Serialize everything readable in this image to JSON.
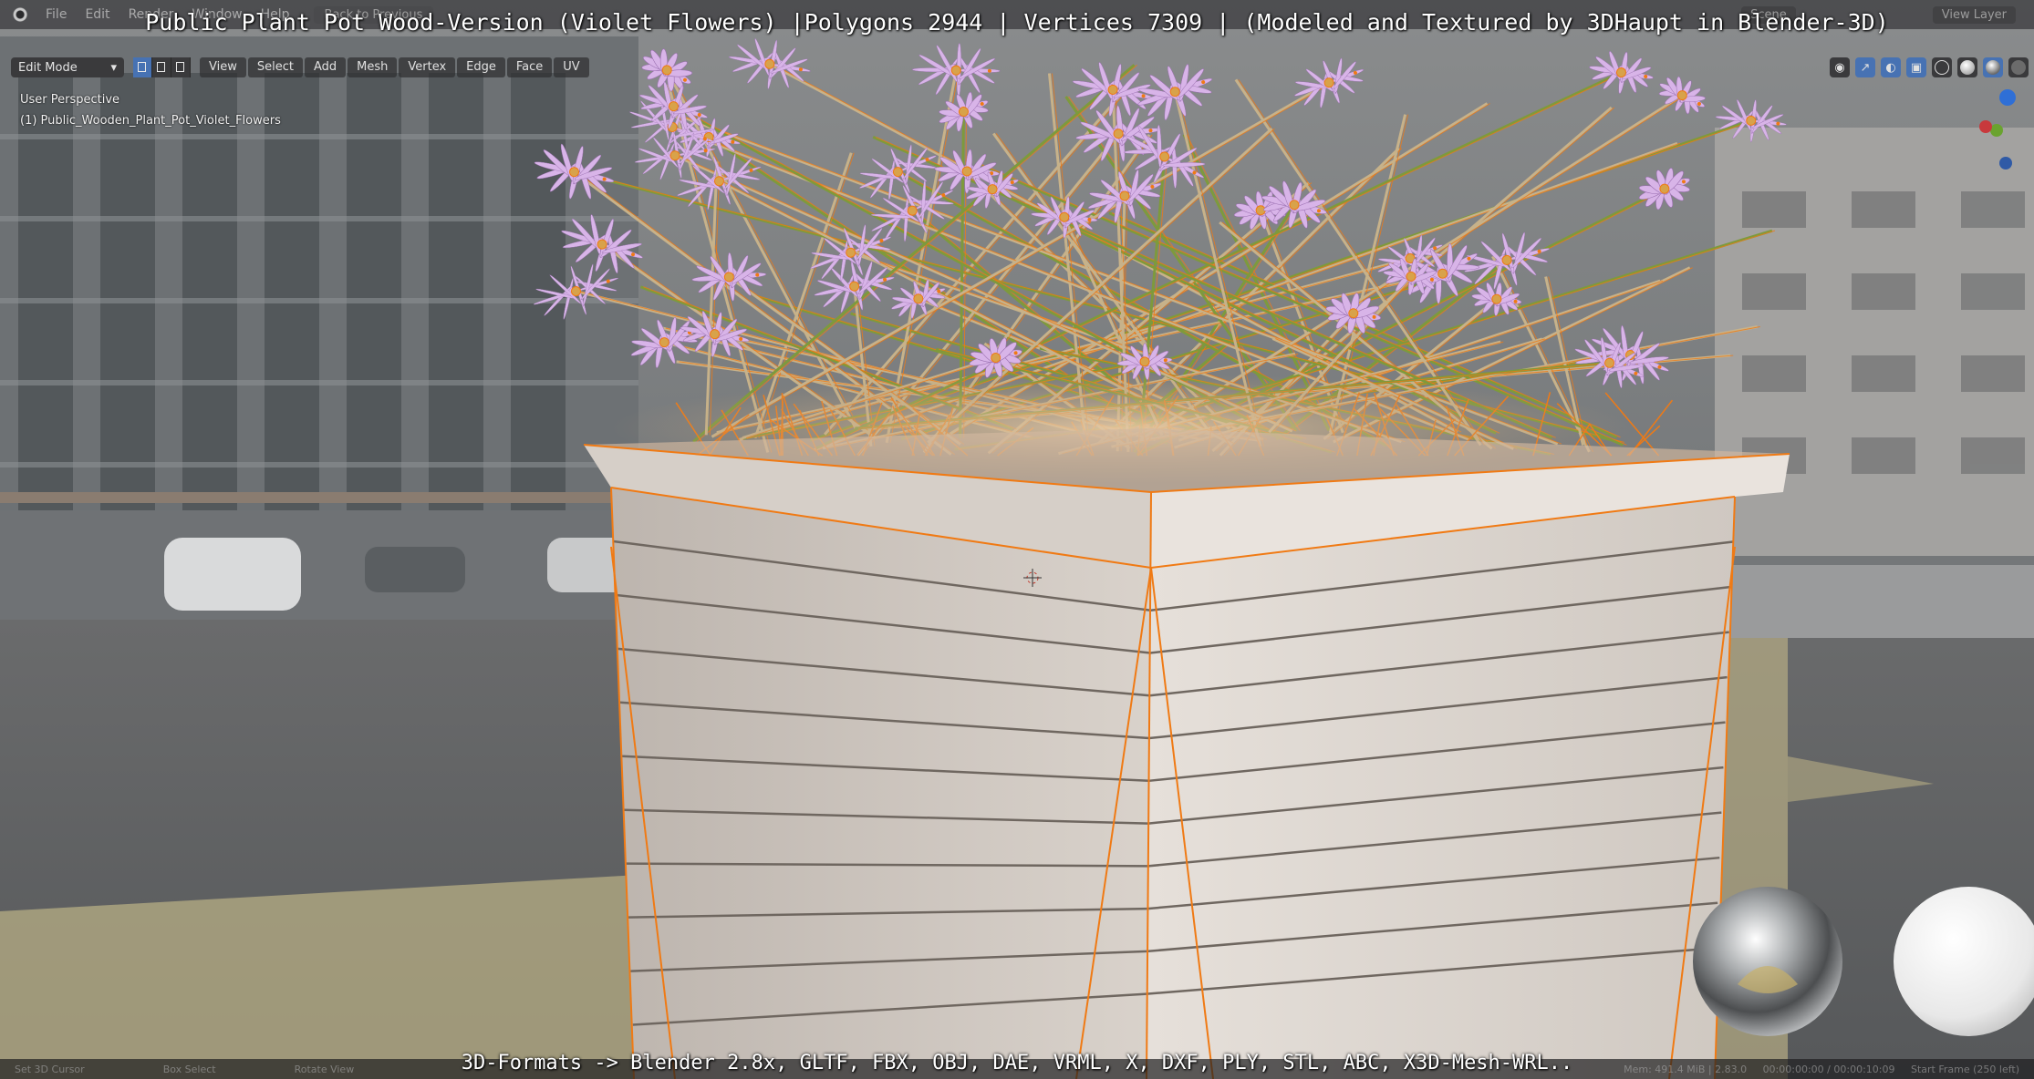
{
  "overlay": {
    "title": "Public Plant Pot Wood-Version (Violet Flowers) |Polygons 2944 | Vertices 7309 | (Modeled and Textured by 3DHaupt in Blender-3D)",
    "formats": "3D-Formats -> Blender 2.8x, GLTF, FBX, OBJ, DAE, VRML, X, DXF, PLY, STL, ABC, X3D-Mesh-WRL.."
  },
  "topbar": {
    "menus": [
      "File",
      "Edit",
      "Render",
      "Window",
      "Help"
    ],
    "back_button": "Back to Previous",
    "scene": "Scene",
    "view_layer": "View Layer"
  },
  "header": {
    "mode": "Edit Mode",
    "menus": [
      "View",
      "Select",
      "Add",
      "Mesh",
      "Vertex",
      "Edge",
      "Face",
      "UV"
    ]
  },
  "viewport": {
    "perspective": "User Perspective",
    "object_name": "(1) Public_Wooden_Plant_Pot_Violet_Flowers"
  },
  "statusbar": {
    "hints": [
      "Set 3D Cursor",
      "Box Select",
      "Rotate View"
    ],
    "mem": "Mem: 491.4 MiB | 2.83.0",
    "time": "00:00:00:00 / 00:00:10:09",
    "frame": "Start Frame (250 left)"
  },
  "colors": {
    "wire": "#f07a14",
    "petal": "#d8b4e8",
    "wood": "#d9d3cc"
  },
  "icons": {
    "logo": "blender-logo-icon",
    "cursor": "3d-cursor-icon"
  }
}
